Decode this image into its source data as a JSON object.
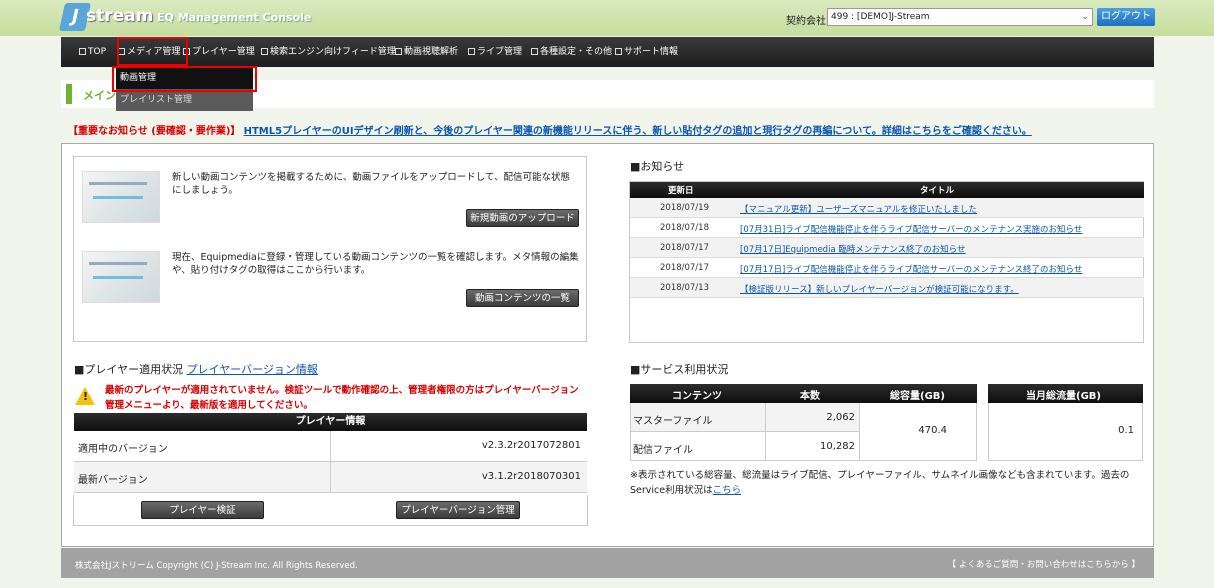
{
  "header": {
    "logo_text": "stream",
    "logo_j": "J",
    "app_title": "EQ Management Console",
    "company_label": "契約会社:",
    "company_value": "499 : [DEMO]J-Stream",
    "logout_label": "ログアウト"
  },
  "nav": {
    "items": [
      {
        "label": "TOP"
      },
      {
        "label": "メディア管理"
      },
      {
        "label": "プレイヤー管理"
      },
      {
        "label": "検索エンジン向けフィード管理"
      },
      {
        "label": "動画視聴解析"
      },
      {
        "label": "ライブ管理"
      },
      {
        "label": "各種設定・その他"
      },
      {
        "label": "サポート情報"
      }
    ],
    "dropdown": [
      {
        "label": "動画管理"
      },
      {
        "label": "プレイリスト管理"
      }
    ]
  },
  "banner": {
    "title": "メイン"
  },
  "notice": {
    "prefix": "【重要なお知らせ (要確認・要作業)】",
    "link": "HTML5プレイヤーのUIデザイン刷新と、今後のプレイヤー関連の新機能リリースに伴う、新しい貼付タグの追加と現行タグの再編について。詳細はこちらをご確認ください。"
  },
  "shortcuts": [
    {
      "desc": "新しい動画コンテンツを掲載するために、動画ファイルをアップロードして、配信可能な状態にしましょう。",
      "button": "新規動画のアップロード"
    },
    {
      "desc": "現在、Equipmediaに登録・管理している動画コンテンツの一覧を確認します。メタ情報の編集や、貼り付けタグの取得はここから行います。",
      "button": "動画コンテンツの一覧"
    }
  ],
  "news": {
    "title": "■お知らせ",
    "col_date": "更新日",
    "col_title": "タイトル",
    "rows": [
      {
        "date": "2018/07/19",
        "title": "【マニュアル更新】ユーザーズマニュアルを修正いたしました"
      },
      {
        "date": "2018/07/18",
        "title": "[07月31日]ライブ配信機能停止を伴うライブ配信サーバーのメンテナンス実施のお知らせ"
      },
      {
        "date": "2018/07/17",
        "title": "[07月17日]Equipmedia 臨時メンテナンス終了のお知らせ"
      },
      {
        "date": "2018/07/17",
        "title": "[07月17日]ライブ配信機能停止を伴うライブ配信サーバーのメンテナンス終了のお知らせ"
      },
      {
        "date": "2018/07/13",
        "title": "【検証版リリース】新しいプレイヤーバージョンが検証可能になります。"
      }
    ]
  },
  "player": {
    "title": "■プレイヤー適用状況",
    "title_link": "プレイヤーバージョン情報",
    "warning": "最新のプレイヤーが適用されていません。検証ツールで動作確認の上、管理者権限の方はプレイヤーバージョン管理メニューより、最新版を適用してください。",
    "table_head": "プレイヤー情報",
    "rows": [
      {
        "key": "適用中のバージョン",
        "value": "v2.3.2r2017072801"
      },
      {
        "key": "最新バージョン",
        "value": "v3.1.2r2018070301"
      }
    ],
    "btn_verify": "プレイヤー検証",
    "btn_manage": "プレイヤーバージョン管理"
  },
  "service": {
    "title": "■サービス利用状況",
    "col_content": "コンテンツ",
    "col_count": "本数",
    "col_total": "総容量(GB)",
    "col_monthly": "当月総流量(GB)",
    "rows": [
      {
        "name": "マスターファイル",
        "count": "2,062"
      },
      {
        "name": "配信ファイル",
        "count": "10,282"
      }
    ],
    "total": "470.4",
    "monthly": "0.1",
    "note": "※表示されている総容量、総流量はライブ配信、プレイヤーファイル、サムネイル画像なども含まれています。過去のService利用状況は",
    "note_link": "こちら"
  },
  "footer": {
    "copyright": "株式会社Jストリーム Copyright (C) J-Stream Inc. All Rights Reserved.",
    "faq": "【 よくあるご質問・お問い合わせはこちらから 】"
  }
}
